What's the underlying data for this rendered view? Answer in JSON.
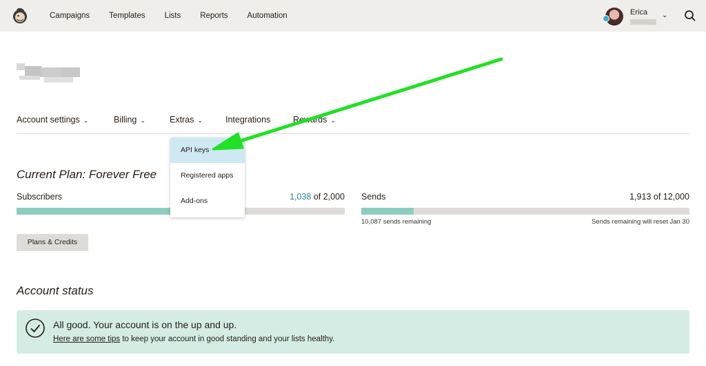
{
  "topbar": {
    "nav": [
      "Campaigns",
      "Templates",
      "Lists",
      "Reports",
      "Automation"
    ],
    "user_name": "Erica",
    "icons": {
      "logo": "mailchimp-freddie-logo",
      "search": "search-icon",
      "chevron": "chevron-down-icon"
    }
  },
  "subnav": {
    "items": [
      {
        "label": "Account settings",
        "has_chevron": true
      },
      {
        "label": "Billing",
        "has_chevron": true
      },
      {
        "label": "Extras",
        "has_chevron": true
      },
      {
        "label": "Integrations",
        "has_chevron": false
      },
      {
        "label": "Rewards",
        "has_chevron": true
      }
    ],
    "chevron_glyph": "⌄"
  },
  "extras_menu": {
    "items": [
      "API keys",
      "Registered apps",
      "Add-ons"
    ],
    "highlighted": "API keys"
  },
  "plan": {
    "title": "Current Plan: Forever Free",
    "subscribers": {
      "label": "Subscribers",
      "used": "1,038",
      "of_text": " of 2,000",
      "fraction": 0.519
    },
    "sends": {
      "label": "Sends",
      "value_text": "1,913 of 12,000",
      "fraction": 0.159,
      "remaining": "10,087 sends remaining",
      "reset": "Sends remaining will reset Jan 30"
    },
    "button": "Plans & Credits"
  },
  "account_status": {
    "title": "Account status",
    "headline": "All good. Your account is on the up and up.",
    "link_text": "Here are some tips",
    "body_rest": " to keep your account in good standing and your lists healthy."
  },
  "colors": {
    "arrow": "#22e026",
    "meter_fill": "#8dcdc0",
    "status_bg": "#d4ece4",
    "accent_link": "#2e82a4",
    "menu_highlight": "#cfe9f3"
  }
}
